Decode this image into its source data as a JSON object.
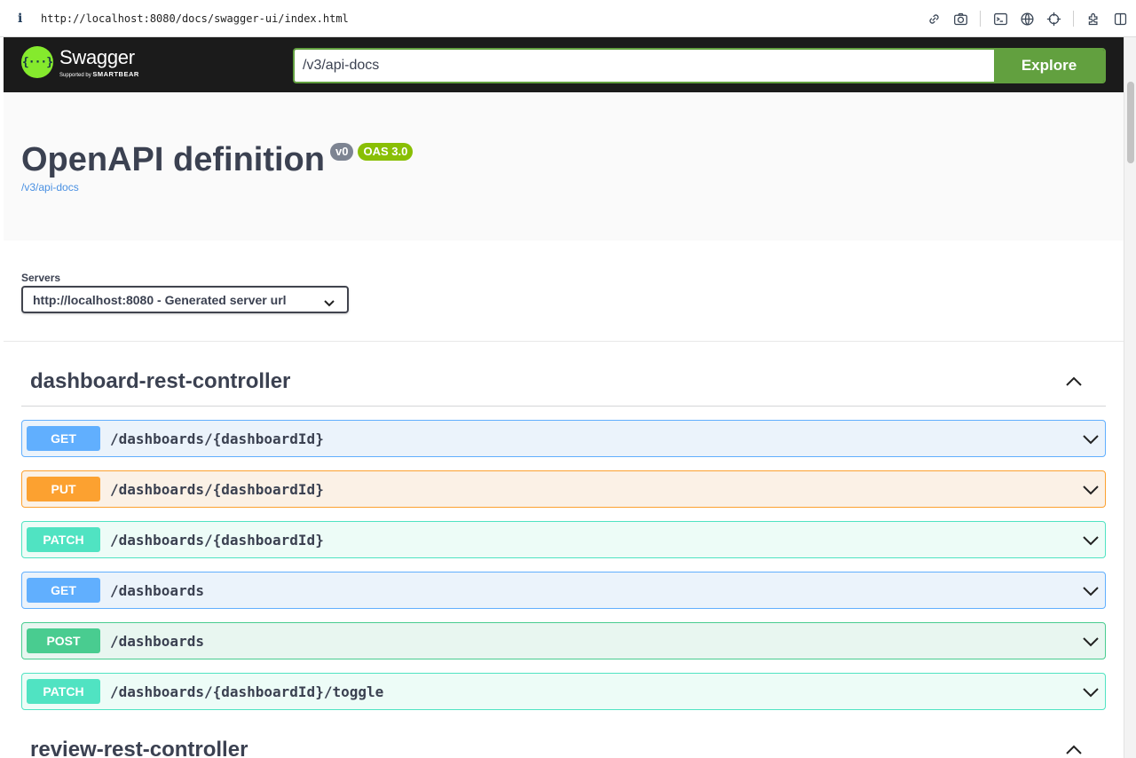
{
  "browser": {
    "info_glyph": "i",
    "url": "http://localhost:8080/docs/swagger-ui/index.html",
    "tools": [
      "link-icon",
      "camera-icon",
      "terminal-icon",
      "globe-icon",
      "crosshair-icon",
      "extension-icon",
      "sidebar-icon"
    ]
  },
  "topbar": {
    "logo_glyph": "{···}",
    "logo_name": "Swagger",
    "logo_supported": "Supported by",
    "logo_company": "SMARTBEAR",
    "search_value": "/v3/api-docs",
    "explore_label": "Explore"
  },
  "info": {
    "title": "OpenAPI definition",
    "version_badge": "v0",
    "oas_badge": "OAS 3.0",
    "spec_link": "/v3/api-docs"
  },
  "servers": {
    "label": "Servers",
    "selected": "http://localhost:8080 - Generated server url"
  },
  "tags": [
    {
      "name": "dashboard-rest-controller",
      "operations": [
        {
          "method": "GET",
          "path": "/dashboards/{dashboardId}"
        },
        {
          "method": "PUT",
          "path": "/dashboards/{dashboardId}"
        },
        {
          "method": "PATCH",
          "path": "/dashboards/{dashboardId}"
        },
        {
          "method": "GET",
          "path": "/dashboards"
        },
        {
          "method": "POST",
          "path": "/dashboards"
        },
        {
          "method": "PATCH",
          "path": "/dashboards/{dashboardId}/toggle"
        }
      ]
    },
    {
      "name": "review-rest-controller",
      "operations": []
    }
  ],
  "colors": {
    "get": "#61affe",
    "put": "#fca130",
    "patch": "#50e3c2",
    "post": "#49cc90",
    "brand_green": "#85ea2d",
    "explore_green": "#62a03f"
  }
}
